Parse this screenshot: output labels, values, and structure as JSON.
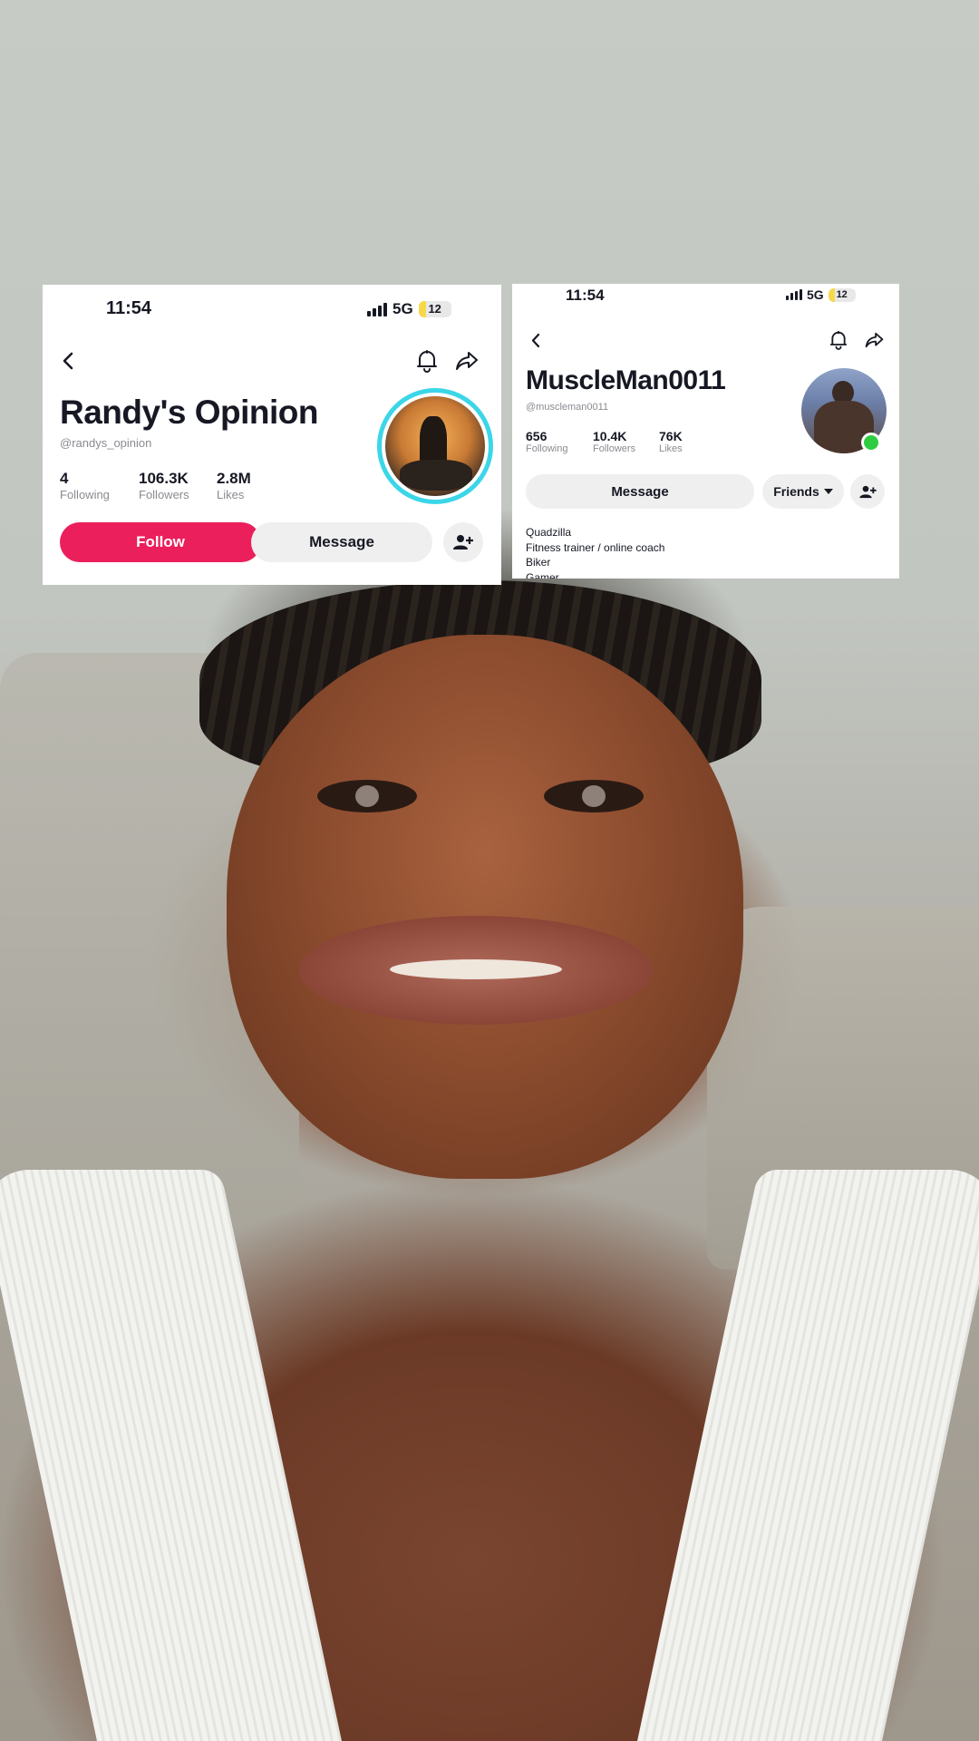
{
  "background": {
    "description_colors": {
      "wall": "#c7cbc5",
      "couch": "#b3b1aa",
      "skin": "#8c4c2e",
      "tank_top": "#f2f2ef"
    }
  },
  "card_left": {
    "status_time": "11:54",
    "network": "5G",
    "battery": "12",
    "title": "Randy's Opinion",
    "handle": "@randys_opinion",
    "stats": [
      {
        "value": "4",
        "label": "Following"
      },
      {
        "value": "106.3K",
        "label": "Followers"
      },
      {
        "value": "2.8M",
        "label": "Likes"
      }
    ],
    "follow_button": "Follow",
    "message_button": "Message",
    "colors": {
      "follow": "#ea1f5b",
      "avatar_ring": "#3bd6e8"
    }
  },
  "card_right": {
    "status_time": "11:54",
    "network": "5G",
    "battery": "12",
    "title": "MuscleMan0011",
    "handle": "@muscleman0011",
    "stats": [
      {
        "value": "656",
        "label": "Following"
      },
      {
        "value": "10.4K",
        "label": "Followers"
      },
      {
        "value": "76K",
        "label": "Likes"
      }
    ],
    "message_button": "Message",
    "friends_button": "Friends",
    "bio_lines": [
      "Quadzilla",
      "Fitness trainer / online coach",
      "Biker",
      "Gamer"
    ],
    "colors": {
      "online_dot": "#2ecc40"
    }
  }
}
